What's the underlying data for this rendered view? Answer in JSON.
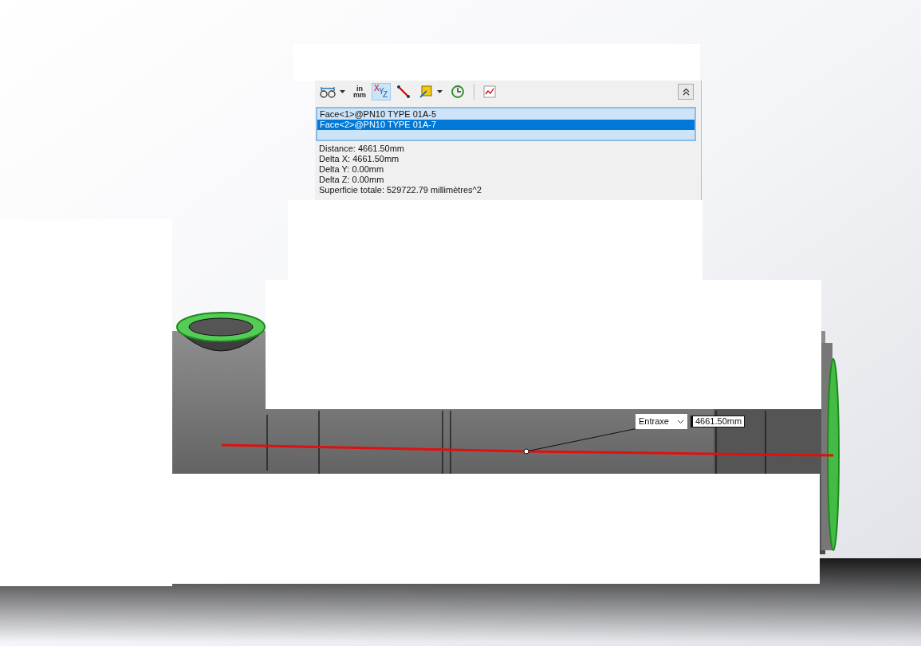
{
  "toolbar": [
    {
      "kind": "binoculars",
      "dropdown": true,
      "selected": false
    },
    {
      "kind": "units",
      "top": "in",
      "bottom": "mm",
      "selected": false
    },
    {
      "kind": "xyz",
      "letters": [
        "X",
        "Y",
        "Z"
      ],
      "selected": true
    },
    {
      "kind": "point-to-point",
      "selected": false
    },
    {
      "kind": "projection",
      "dropdown": true,
      "selected": false
    },
    {
      "kind": "history",
      "selected": false
    },
    {
      "kind": "separator"
    },
    {
      "kind": "sensor",
      "selected": false
    }
  ],
  "selections": [
    {
      "label": "Face<1>@PN10 TYPE 01A-5",
      "selected": false
    },
    {
      "label": "Face<2>@PN10 TYPE 01A-7",
      "selected": true
    }
  ],
  "results": [
    "Distance: 4661.50mm",
    "Delta X: 4661.50mm",
    "Delta Y: 0.00mm",
    "Delta Z: 0.00mm",
    "Superficie totale: 529722.79 millimètres^2"
  ],
  "callout": {
    "dimension_type": "Entraxe",
    "value": "4661.50mm"
  }
}
